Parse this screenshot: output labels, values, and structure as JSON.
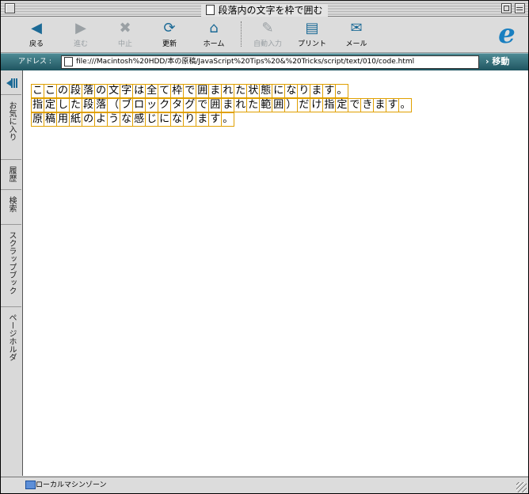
{
  "window": {
    "title": "段落内の文字を枠で囲む"
  },
  "toolbar": {
    "buttons": [
      {
        "label": "戻る",
        "icon": "◀",
        "enabled": true
      },
      {
        "label": "進む",
        "icon": "▶",
        "enabled": false
      },
      {
        "label": "中止",
        "icon": "✖",
        "enabled": false
      },
      {
        "label": "更新",
        "icon": "⟳",
        "enabled": true
      },
      {
        "label": "ホーム",
        "icon": "⌂",
        "enabled": true
      },
      {
        "label": "自動入力",
        "icon": "✎",
        "enabled": false
      },
      {
        "label": "プリント",
        "icon": "▤",
        "enabled": true
      },
      {
        "label": "メール",
        "icon": "✉",
        "enabled": true
      }
    ],
    "logo": "e"
  },
  "address": {
    "label": "アドレス :",
    "url": "file:///Macintosh%20HDD/本の原稿/JavaScript%20Tips%20&%20Tricks/script/text/010/code.html",
    "go_label": "› 移動"
  },
  "sidebar": {
    "tabs": [
      "お気に入り",
      "履歴",
      "検索",
      "スクラップブック",
      "ページホルダ"
    ]
  },
  "content": {
    "paragraphs": [
      "ここの段落の文字は全て枠で囲まれた状態になります。",
      "指定した段落（ブロックタグで囲まれた範囲）だけ指定できます。",
      "原稿用紙のような感じになります。"
    ],
    "border_color": "#e0a000"
  },
  "status": {
    "zone": "ローカルマシンゾーン"
  }
}
